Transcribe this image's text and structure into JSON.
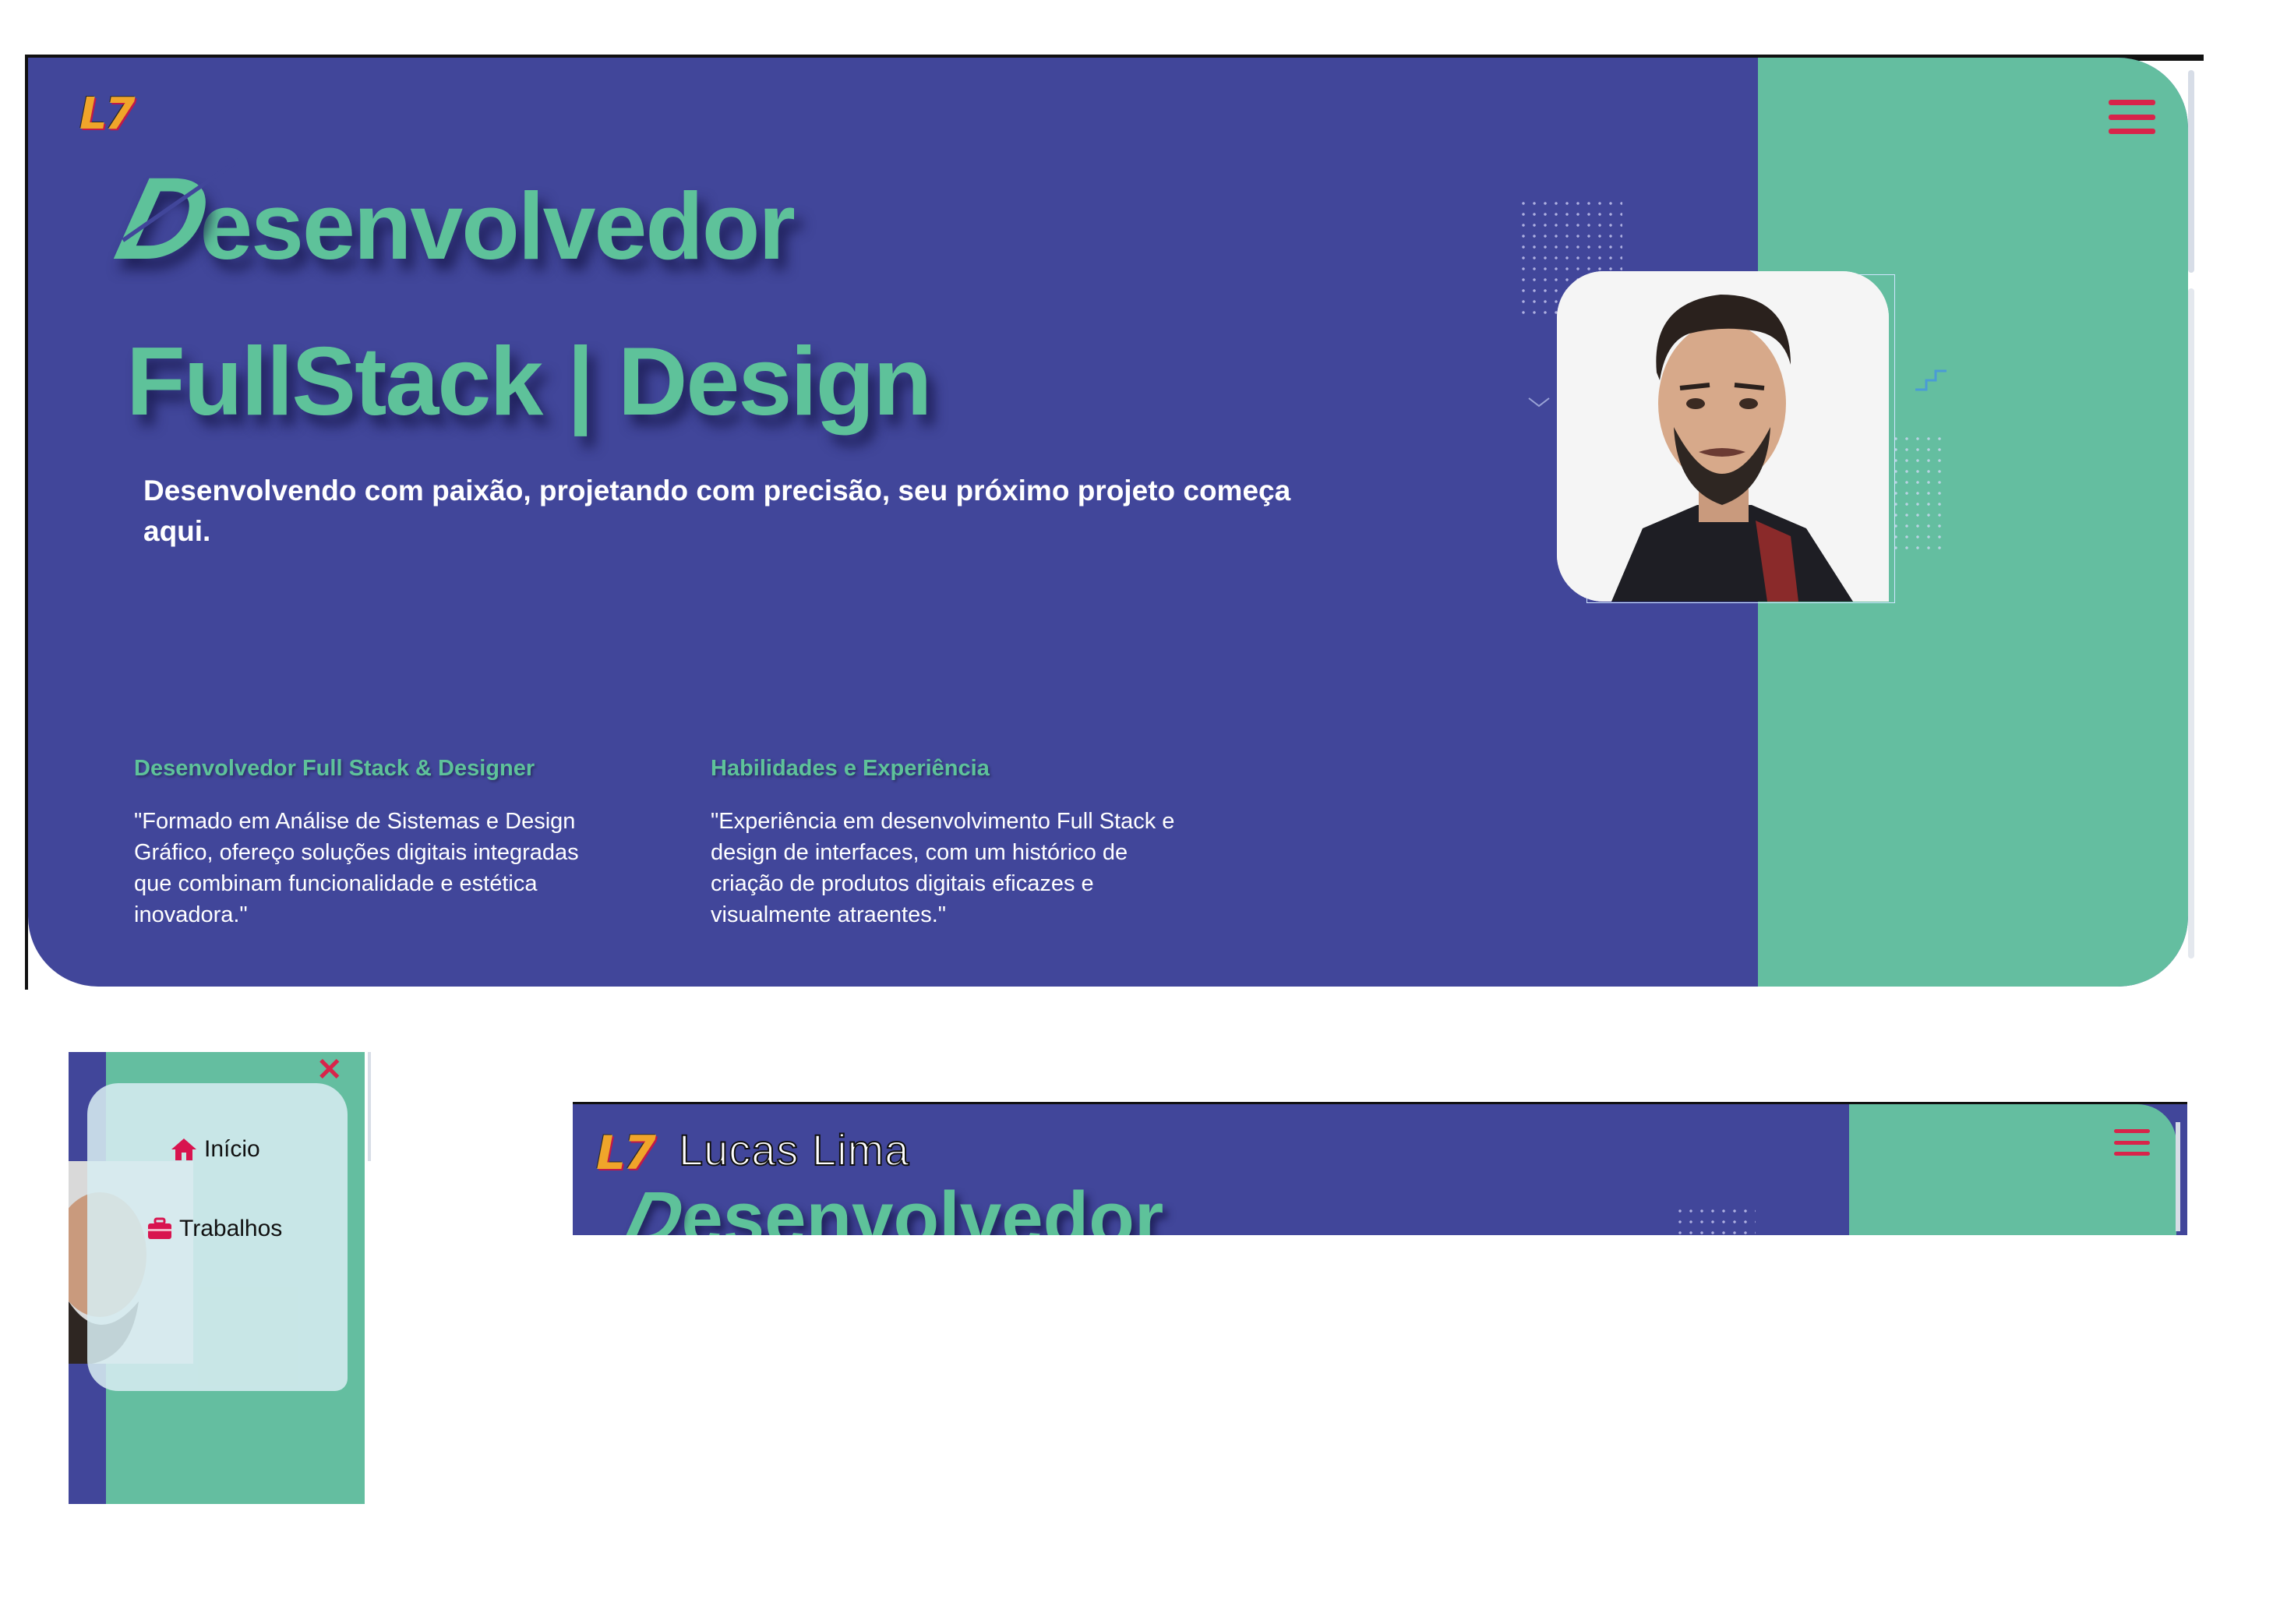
{
  "hero": {
    "logo": "L7",
    "title_initial": "D",
    "title_rest": "esenvolvedor",
    "title_line2": "FullStack | Design",
    "subtitle": "Desenvolvendo com paixão, projetando com precisão, seu próximo projeto começa aqui.",
    "columns": [
      {
        "heading": "Desenvolvedor Full Stack & Designer",
        "text": "\"Formado em Análise de Sistemas e Design Gráfico, ofereço soluções digitais integradas que combinam funcionalidade e estética inovadora.\""
      },
      {
        "heading": "Habilidades e Experiência",
        "text": "\"Experiência em desenvolvimento Full Stack e design de interfaces, com um histórico de criação de produtos digitais eficazes e visualmente atraentes.\""
      }
    ]
  },
  "mobile_menu": {
    "close_icon": "close-icon",
    "items": [
      {
        "label": "Início",
        "icon": "home-icon"
      },
      {
        "label": "Trabalhos",
        "icon": "briefcase-icon"
      }
    ]
  },
  "preview": {
    "logo": "L7",
    "name": "Lucas Lima",
    "title_initial": "D",
    "title_rest": "esenvolvedor"
  },
  "colors": {
    "primary_blue": "#41469a",
    "accent_green": "#64bea0",
    "title_green": "#5ec29a",
    "menu_red": "#d8244a"
  }
}
